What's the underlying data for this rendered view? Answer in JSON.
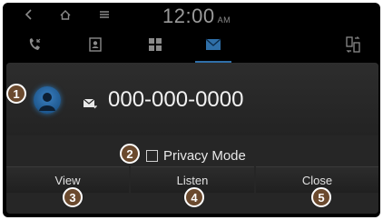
{
  "status": {
    "time": "12:00",
    "ampm": "AM"
  },
  "contact": {
    "number": "000-000-0000"
  },
  "privacy": {
    "label": "Privacy Mode",
    "checked": false
  },
  "buttons": {
    "view": "View",
    "listen": "Listen",
    "close": "Close"
  },
  "callouts": [
    "1",
    "2",
    "3",
    "4",
    "5"
  ],
  "colors": {
    "accent": "#2f6fa8",
    "callout": "#6b4a2e"
  },
  "icons": [
    "back-icon",
    "home-icon",
    "menu-icon",
    "call-log-icon",
    "contacts-icon",
    "grid-icon",
    "message-icon",
    "phone-switch-icon",
    "avatar-icon",
    "mail-icon"
  ]
}
